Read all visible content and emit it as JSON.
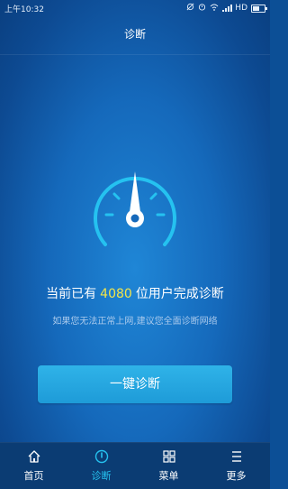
{
  "status_bar": {
    "time": "上午10:32",
    "network": "HD"
  },
  "title": "诊断",
  "summary": {
    "prefix": "当前已有",
    "user_count": "4080",
    "suffix": "位用户完成诊断",
    "hint": "如果您无法正常上网,建议您全面诊断网络"
  },
  "diagnose_button": "一键诊断",
  "nav": [
    {
      "label": "首页",
      "icon": "home-icon"
    },
    {
      "label": "诊断",
      "icon": "diagnose-icon",
      "active": true
    },
    {
      "label": "菜单",
      "icon": "grid-icon"
    },
    {
      "label": "更多",
      "icon": "more-icon"
    }
  ],
  "colors": {
    "background": "#1569bb",
    "accent": "#25c2f0",
    "count_highlight": "#f2e54a",
    "button": "#2fb3e8",
    "nav_bg": "#0b3c73"
  }
}
